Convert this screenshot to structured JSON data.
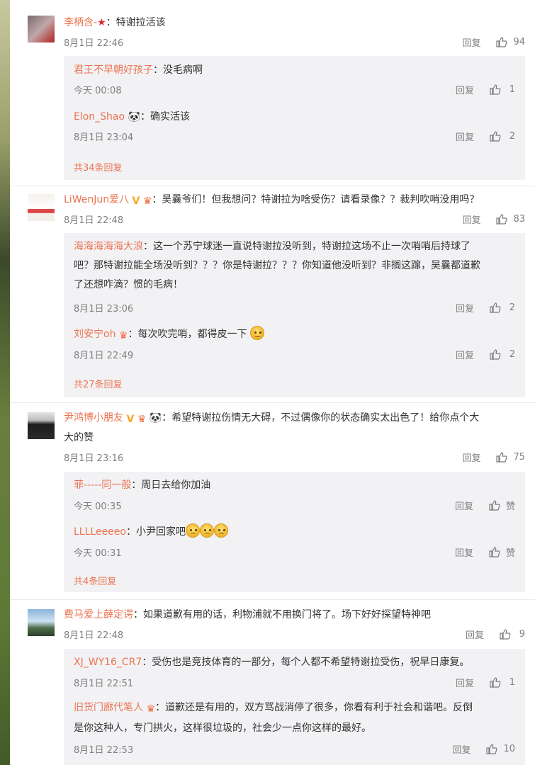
{
  "colors": {
    "username": "#eb7350",
    "meta": "#808080",
    "text": "#333333",
    "subbg": "#f2f2f5"
  },
  "labels": {
    "reply": "回复",
    "colon": "："
  },
  "comments": [
    {
      "user": "李柄含-",
      "text": "特谢拉活该",
      "time": "8月1日 22:46",
      "likes": "94",
      "replies": [
        {
          "user": "君王不早朝好孩子",
          "text": "没毛病啊",
          "time": "今天 00:08",
          "likes": "1"
        },
        {
          "user": "Elon_Shao",
          "text": "确实活该",
          "time": "8月1日 23:04",
          "likes": "2"
        }
      ],
      "more": "共34条回复"
    },
    {
      "user": "LiWenJun爱八",
      "text": "吴曩爷们！但我想问？特谢拉为啥受伤？请看录像？？裁判吹哨没用吗？",
      "time": "8月1日 22:48",
      "likes": "83",
      "replies": [
        {
          "user": "海海海海海大浪",
          "text_lines": [
            "这一个苏宁球迷一直说特谢拉没听到，特谢拉这场不止一次哨哨后持球了",
            "吧？那特谢拉能全场没听到？？？你是特谢拉？？？你知道他没听到？非搁这蹿，吴曩都道歉",
            "了还想咋滴？惯的毛病！"
          ],
          "time": "8月1日 23:06",
          "likes": "2"
        },
        {
          "user": "刘安宁oh",
          "text": "每次吹完哨，都得皮一下",
          "time": "8月1日 22:49",
          "likes": "2"
        }
      ],
      "more": "共27条回复"
    },
    {
      "user": "尹鸿博小朋友",
      "text_lines": [
        "希望特谢拉伤情无大碍，不过偶像你的状态确实太出色了！给你点个大",
        "大的赞"
      ],
      "time": "8月1日 23:16",
      "likes": "75",
      "replies": [
        {
          "user": "菲-----同一般",
          "text": "周日去给你加油",
          "time": "今天 00:35",
          "likes": "赞"
        },
        {
          "user": "LLLLeeeeo",
          "text": "小尹回家吧",
          "time": "今天 00:31",
          "likes": "赞"
        }
      ],
      "more": "共4条回复"
    },
    {
      "user": "费马爱上薛定谔",
      "text": "如果道歉有用的话，利物浦就不用换门将了。场下好好探望特神吧",
      "time": "8月1日 22:48",
      "likes": "9",
      "replies": [
        {
          "user": "XJ_WY16_CR7",
          "text": "受伤也是竞技体育的一部分，每个人都不希望特谢拉受伤，祝早日康复。",
          "time": "8月1日 22:51",
          "likes": "1"
        },
        {
          "user": "旧货门廊代笔人",
          "text_lines": [
            "道歉还是有用的，双方骂战消停了很多，你看有利于社会和谐吧。反倒",
            "是你这种人，专门拱火，这样很垃圾的，社会少一点你这样的最好。"
          ],
          "time": "8月1日 22:53",
          "likes": "10"
        }
      ]
    }
  ]
}
